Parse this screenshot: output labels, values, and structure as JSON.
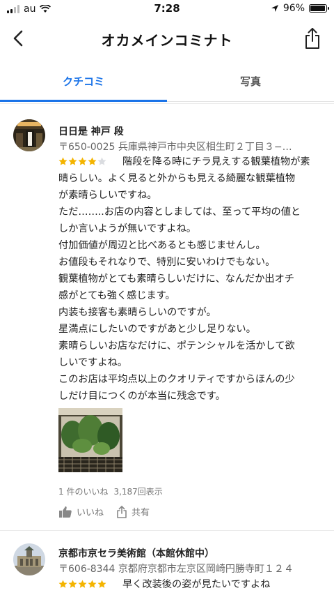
{
  "status_bar": {
    "carrier": "au",
    "time": "7:28",
    "battery": "96%",
    "battery_level": 0.96
  },
  "header": {
    "title": "オカメインコミナト",
    "back_icon": "chevron-left-icon",
    "share_icon": "share-icon"
  },
  "tabs": [
    {
      "label": "クチコミ",
      "active": true
    },
    {
      "label": "写真",
      "active": false
    }
  ],
  "reviews": [
    {
      "author": "日日是 神戸 段",
      "address": "〒650-0025 兵庫県神戸市中央区相生町２丁目３−…",
      "rating": 4,
      "text_lines": [
        "階段を降る時にチラ見えする観葉植物が素",
        "晴らしい。よく見ると外からも見える綺麗な観葉植物",
        "が素晴らしいですね。",
        "ただ……..お店の内容としましては、至って平均の値と",
        "しか言いようが無いですよね。",
        "付加価値が周辺と比べあるとも感じませんし。",
        "お値段もそれなりで、特別に安いわけでもない。",
        "観葉植物がとても素晴らしいだけに、なんだか出オチ",
        "感がとても強く感じます。",
        "内装も接客も素晴らしいのですが。",
        "星満点にしたいのですがあと少し足りない。",
        "素晴らしいお店なだけに、ポテンシャルを活かして欲",
        "しいですよね。",
        "このお店は平均点以上のクオリティですからほんの少",
        "しだけ目につくのが本当に残念です。"
      ],
      "likes": "1 件のいいね",
      "views": "3,187回表示",
      "like_label": "いいね",
      "share_label": "共有"
    },
    {
      "author": "京都市京セラ美術館（本館休館中）",
      "address": "〒606-8344 京都府京都市左京区岡崎円勝寺町１２４",
      "rating": 5,
      "text_lines": [
        "早く改装後の姿が見たいですよね"
      ]
    }
  ],
  "colors": {
    "accent": "#1a73e8",
    "star": "#f4b400",
    "star_empty": "#dadce0"
  }
}
